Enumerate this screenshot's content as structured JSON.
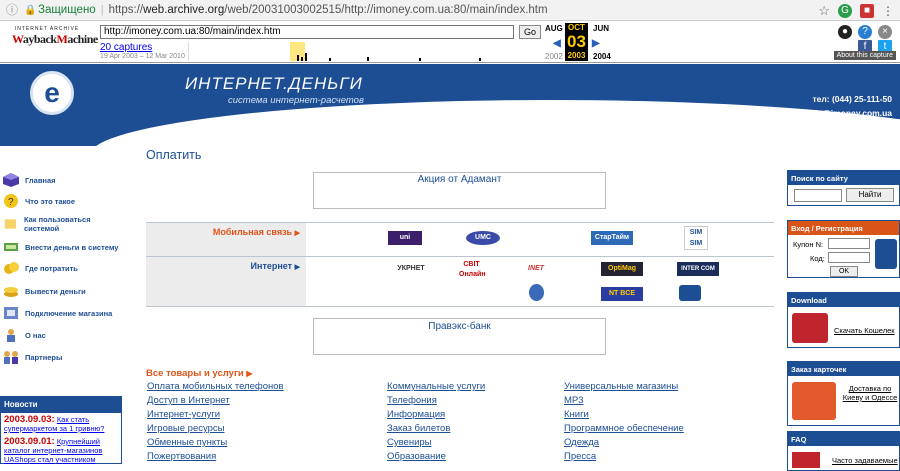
{
  "browser": {
    "secure_label": "Защищено",
    "url_prefix": "https://",
    "url_host": "web.archive.org",
    "url_path": "/web/20031003002515/http://imoney.com.ua:80/main/index.htm"
  },
  "wayback": {
    "logo_top": "INTERNET ARCHIVE",
    "logo_main": "WaybackMachine",
    "url_value": "http://imoney.com.ua:80/main/index.htm",
    "go_label": "Go",
    "captures": "20 captures",
    "date_range": "19 Apr 2003 – 12 Mar 2010",
    "prev_month": "AUG",
    "cur_month": "OCT",
    "next_month": "JUN",
    "cur_day": "03",
    "prev_year": "2002",
    "cur_year": "2003",
    "next_year": "2004",
    "about": "About this capture"
  },
  "header": {
    "site_name": "ИНТЕРНЕТ.ДЕНЬГИ",
    "tagline": "система интернет-расчетов",
    "phone": "тел: (044) 25-111-50",
    "email": "e-mail: info@imoney.com.ua"
  },
  "nav": {
    "items": [
      {
        "label": "Главная"
      },
      {
        "label": "Что это такое"
      },
      {
        "label": "Как пользоваться системой"
      },
      {
        "label": "Внести деньги в систему"
      },
      {
        "label": "Где потратить"
      },
      {
        "label": "Вывести деньги"
      },
      {
        "label": "Подключение магазина"
      },
      {
        "label": "О нас"
      },
      {
        "label": "Партнеры"
      }
    ]
  },
  "news": {
    "title": "Новости",
    "items": [
      {
        "date": "2003.09.03:",
        "text": "Как стать супермаркетом за 1 гривню?"
      },
      {
        "date": "2003.09.01:",
        "text": "Крупнейший каталог интернет-магазинов UAShops стал участником"
      }
    ]
  },
  "main": {
    "title": "Оплатить",
    "banner1": "Акция от Адамант",
    "banner2": "Правэкс-банк",
    "cat_mobile": "Мобильная связь",
    "cat_internet": "Интернет",
    "mobile_logos": [
      "uni",
      "UMC",
      "СтарТайм",
      "SIM SIM"
    ],
    "internet_logos": [
      "УКРНЕТ",
      "СВІТ Онлайн",
      "INET",
      "OptiMag",
      "INTER COM",
      "",
      "NT BCE",
      ""
    ],
    "all_goods": "Все товары и услуги",
    "col1": [
      "Оплата мобильных телефонов",
      "Доступ в Интернет",
      "Интернет-услуги",
      "Игровые ресурсы",
      "Обменные пункты",
      "Пожертвования"
    ],
    "col2": [
      "Коммунальные услуги",
      "Телефония",
      "Информация",
      "Заказ билетов",
      "Сувениры",
      "Образование"
    ],
    "col3": [
      "Универсальные магазины",
      "MP3",
      "Книги",
      "Программное обеспечение",
      "Одежда",
      "Пресса"
    ]
  },
  "sidebar": {
    "search_title": "Поиск по сайту",
    "search_button": "Найти",
    "login_title": "Вход / Регистрация",
    "purse_label": "Купон N:",
    "code_label": "Код:",
    "ok_label": "OK",
    "download_title": "Download",
    "download_link": "Скачать Кошелек",
    "order_title": "Заказ карточек",
    "order_link": "Доставка по Киеву и Одессе",
    "faq_title": "FAQ",
    "faq_link": "Часто задаваемые"
  },
  "colors": {
    "brand_blue": "#1d4e94",
    "accent_orange": "#e0541a"
  }
}
